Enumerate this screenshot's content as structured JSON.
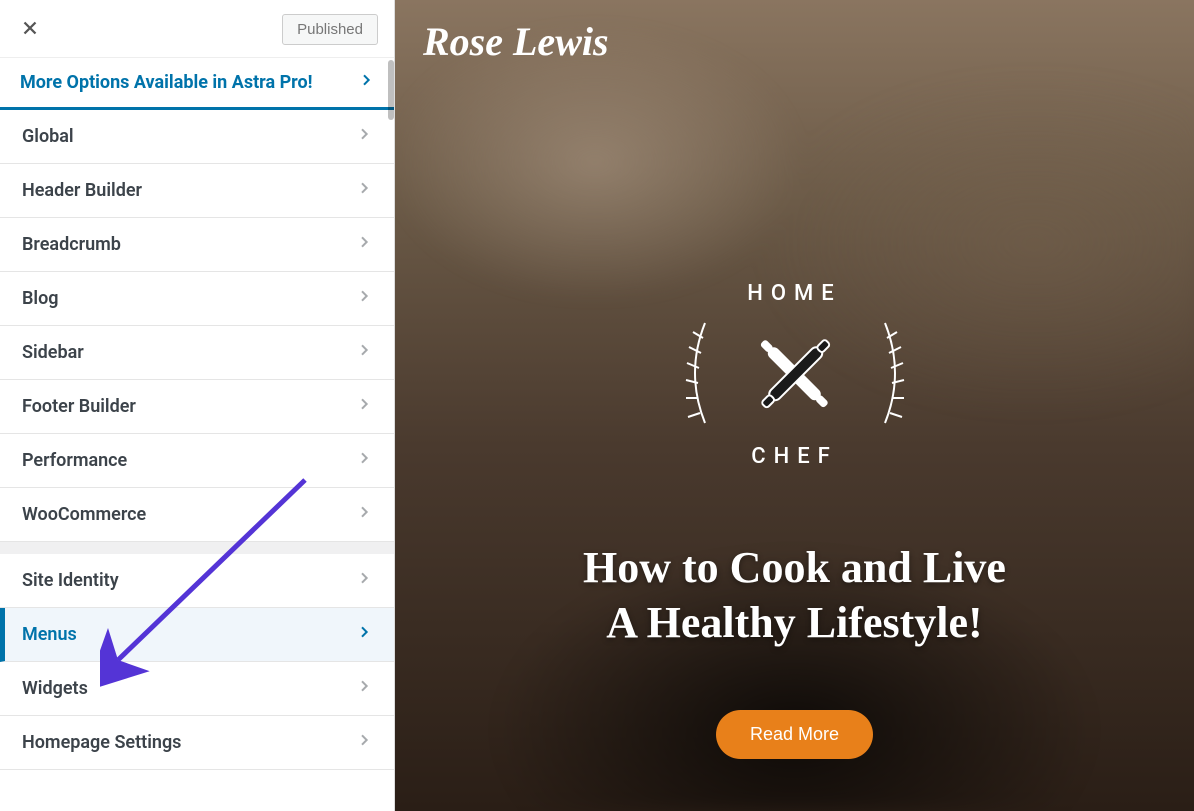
{
  "sidebar": {
    "published_label": "Published",
    "promo_label": "More Options Available in Astra Pro!",
    "items": [
      {
        "label": "Global",
        "active": false
      },
      {
        "label": "Header Builder",
        "active": false
      },
      {
        "label": "Breadcrumb",
        "active": false
      },
      {
        "label": "Blog",
        "active": false
      },
      {
        "label": "Sidebar",
        "active": false
      },
      {
        "label": "Footer Builder",
        "active": false
      },
      {
        "label": "Performance",
        "active": false
      },
      {
        "label": "WooCommerce",
        "active": false
      },
      {
        "label": "Site Identity",
        "active": false,
        "section_gap": true
      },
      {
        "label": "Menus",
        "active": true
      },
      {
        "label": "Widgets",
        "active": false
      },
      {
        "label": "Homepage Settings",
        "active": false
      }
    ]
  },
  "preview": {
    "brand": "Rose Lewis",
    "badge_top": "HOME",
    "badge_bottom": "CHEF",
    "hero_line1": "How to Cook and Live",
    "hero_line2": "A Healthy Lifestyle!",
    "cta_label": "Read More"
  }
}
